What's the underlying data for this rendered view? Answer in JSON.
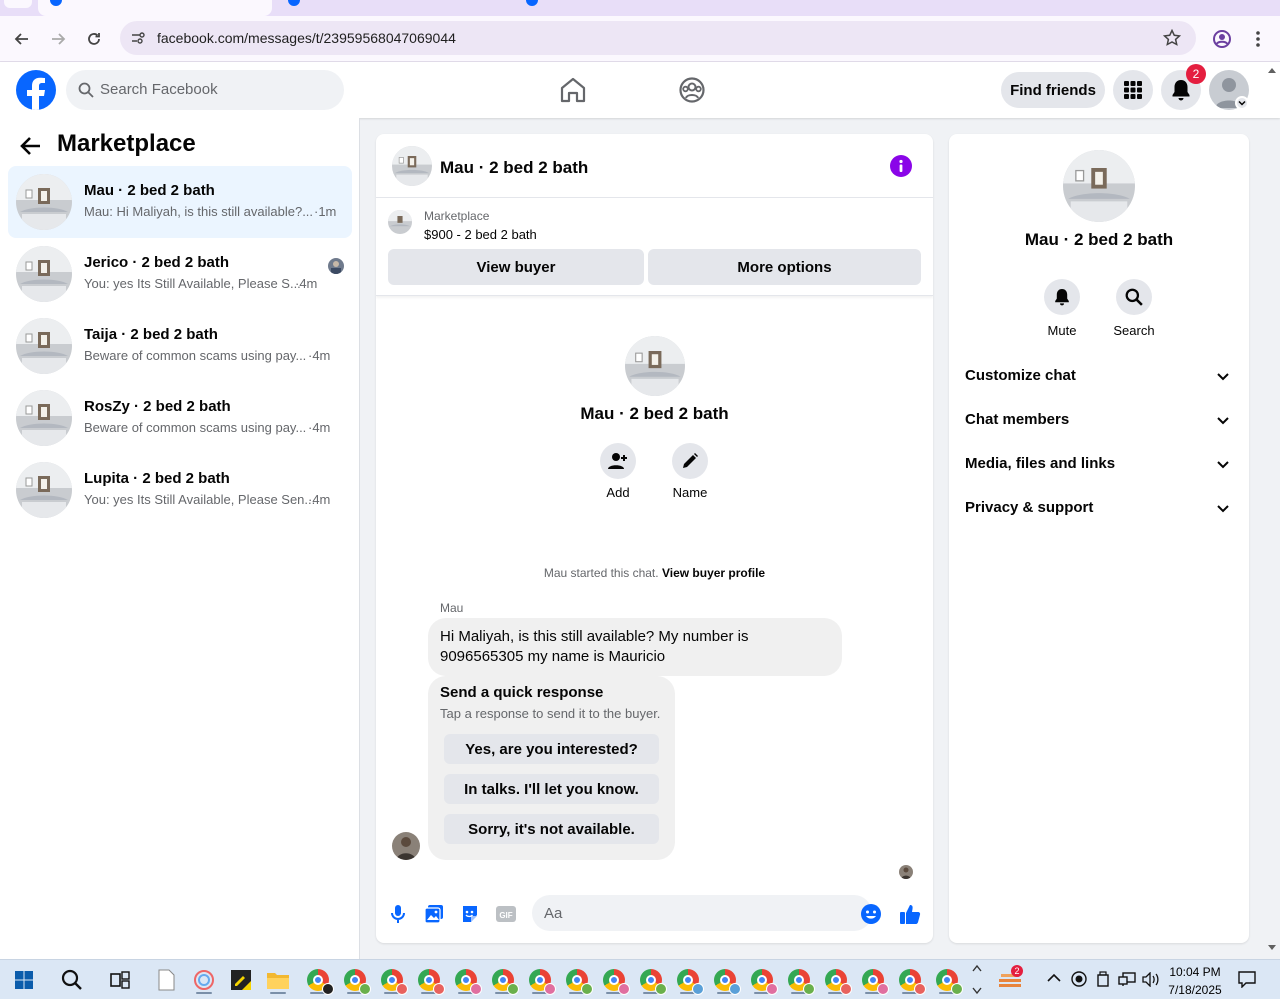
{
  "browser": {
    "url": "facebook.com/messages/t/23959568047069044"
  },
  "header": {
    "search_placeholder": "Search Facebook",
    "find_friends_label": "Find friends",
    "notification_count": "2"
  },
  "left_panel": {
    "title": "Marketplace",
    "conversations": [
      {
        "name": "Mau · 2 bed 2 bath",
        "preview": "Mau: Hi Maliyah, is this still available?...",
        "time": "·1m",
        "active": true
      },
      {
        "name": "Jerico · 2 bed 2 bath",
        "preview": "You: yes Its Still Available, Please S...",
        "time": "·4m"
      },
      {
        "name": "Taija · 2 bed 2 bath",
        "preview": "Beware of common scams using pay...",
        "time": "·4m"
      },
      {
        "name": "RosZy · 2 bed 2 bath",
        "preview": "Beware of common scams using pay...",
        "time": "·4m"
      },
      {
        "name": "Lupita · 2 bed 2 bath",
        "preview": "You: yes Its Still Available, Please Sen...",
        "time": "·4m"
      }
    ]
  },
  "chat": {
    "title": "Mau · 2 bed 2 bath",
    "marketplace_label": "Marketplace",
    "listing": "$900 - 2 bed 2 bath",
    "view_buyer_label": "View buyer",
    "more_options_label": "More options",
    "intro_name": "Mau · 2 bed 2 bath",
    "add_label": "Add",
    "name_label": "Name",
    "started_text": "Mau started this chat.",
    "view_profile_label": "View buyer profile",
    "sender": "Mau",
    "message": "Hi Maliyah, is this still available? My number is 9096565305 my name is Mauricio",
    "quick_title": "Send a quick response",
    "quick_sub": "Tap a response to send it to the buyer.",
    "quick_responses": [
      "Yes, are you interested?",
      "In talks. I'll let you know.",
      "Sorry, it's not available."
    ],
    "input_placeholder": "Aa"
  },
  "right_panel": {
    "name": "Mau · 2 bed 2 bath",
    "mute_label": "Mute",
    "search_label": "Search",
    "sections": [
      "Customize chat",
      "Chat members",
      "Media, files and links",
      "Privacy & support"
    ]
  },
  "taskbar": {
    "time": "10:04 PM",
    "date": "7/18/2025",
    "tray_badge": "2"
  },
  "colors": {
    "brand": "#0866ff",
    "info": "#8a05e8",
    "badge": "#e41e3f"
  }
}
